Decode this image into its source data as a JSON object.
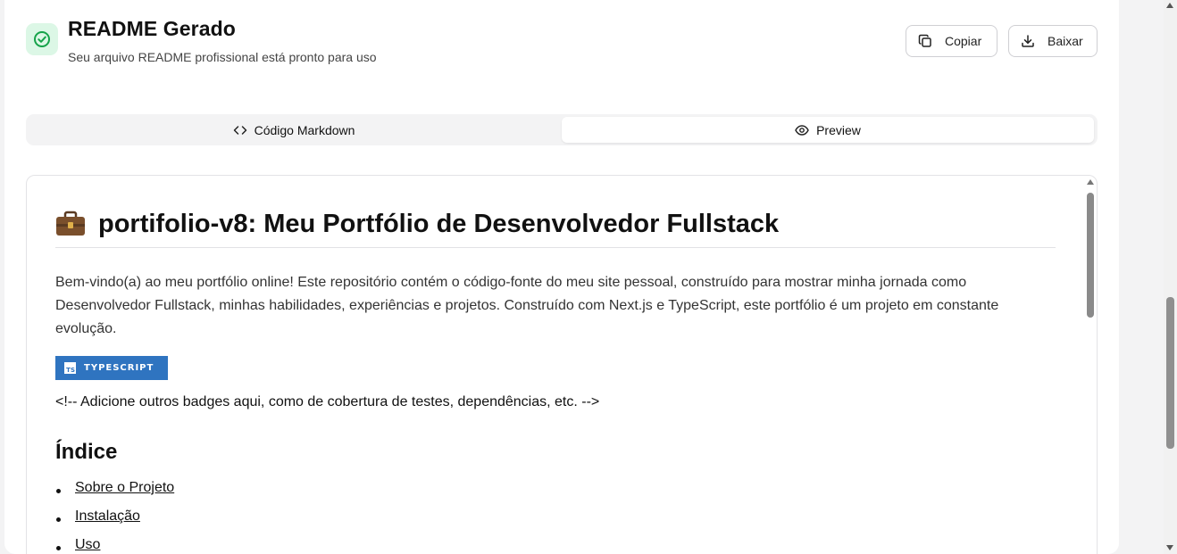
{
  "header": {
    "title": "README Gerado",
    "subtitle": "Seu arquivo README profissional está pronto para uso",
    "copy_label": "Copiar",
    "download_label": "Baixar"
  },
  "tabs": [
    {
      "label": "Código Markdown",
      "icon": "code-icon",
      "active": false
    },
    {
      "label": "Preview",
      "icon": "eye-icon",
      "active": true
    }
  ],
  "preview": {
    "heading_icon": "briefcase-icon",
    "heading": "portifolio-v8: Meu Portfólio de Desenvolvedor Fullstack",
    "intro": "Bem-vindo(a) ao meu portfólio online! Este repositório contém o código-fonte do meu site pessoal, construído para mostrar minha jornada como Desenvolvedor Fullstack, minhas habilidades, experiências e projetos. Construído com Next.js e TypeScript, este portfólio é um projeto em constante evolução.",
    "badge_label": "TYPESCRIPT",
    "badge_logo_text": "TS",
    "comment": "<!-- Adicione outros badges aqui, como de cobertura de testes, dependências, etc. -->",
    "toc_heading": "Índice",
    "toc": [
      "Sobre o Projeto",
      "Instalação",
      "Uso"
    ]
  },
  "colors": {
    "success_bg": "#dcf7e6",
    "success": "#16a34a",
    "badge_bg": "#2f74c0"
  }
}
